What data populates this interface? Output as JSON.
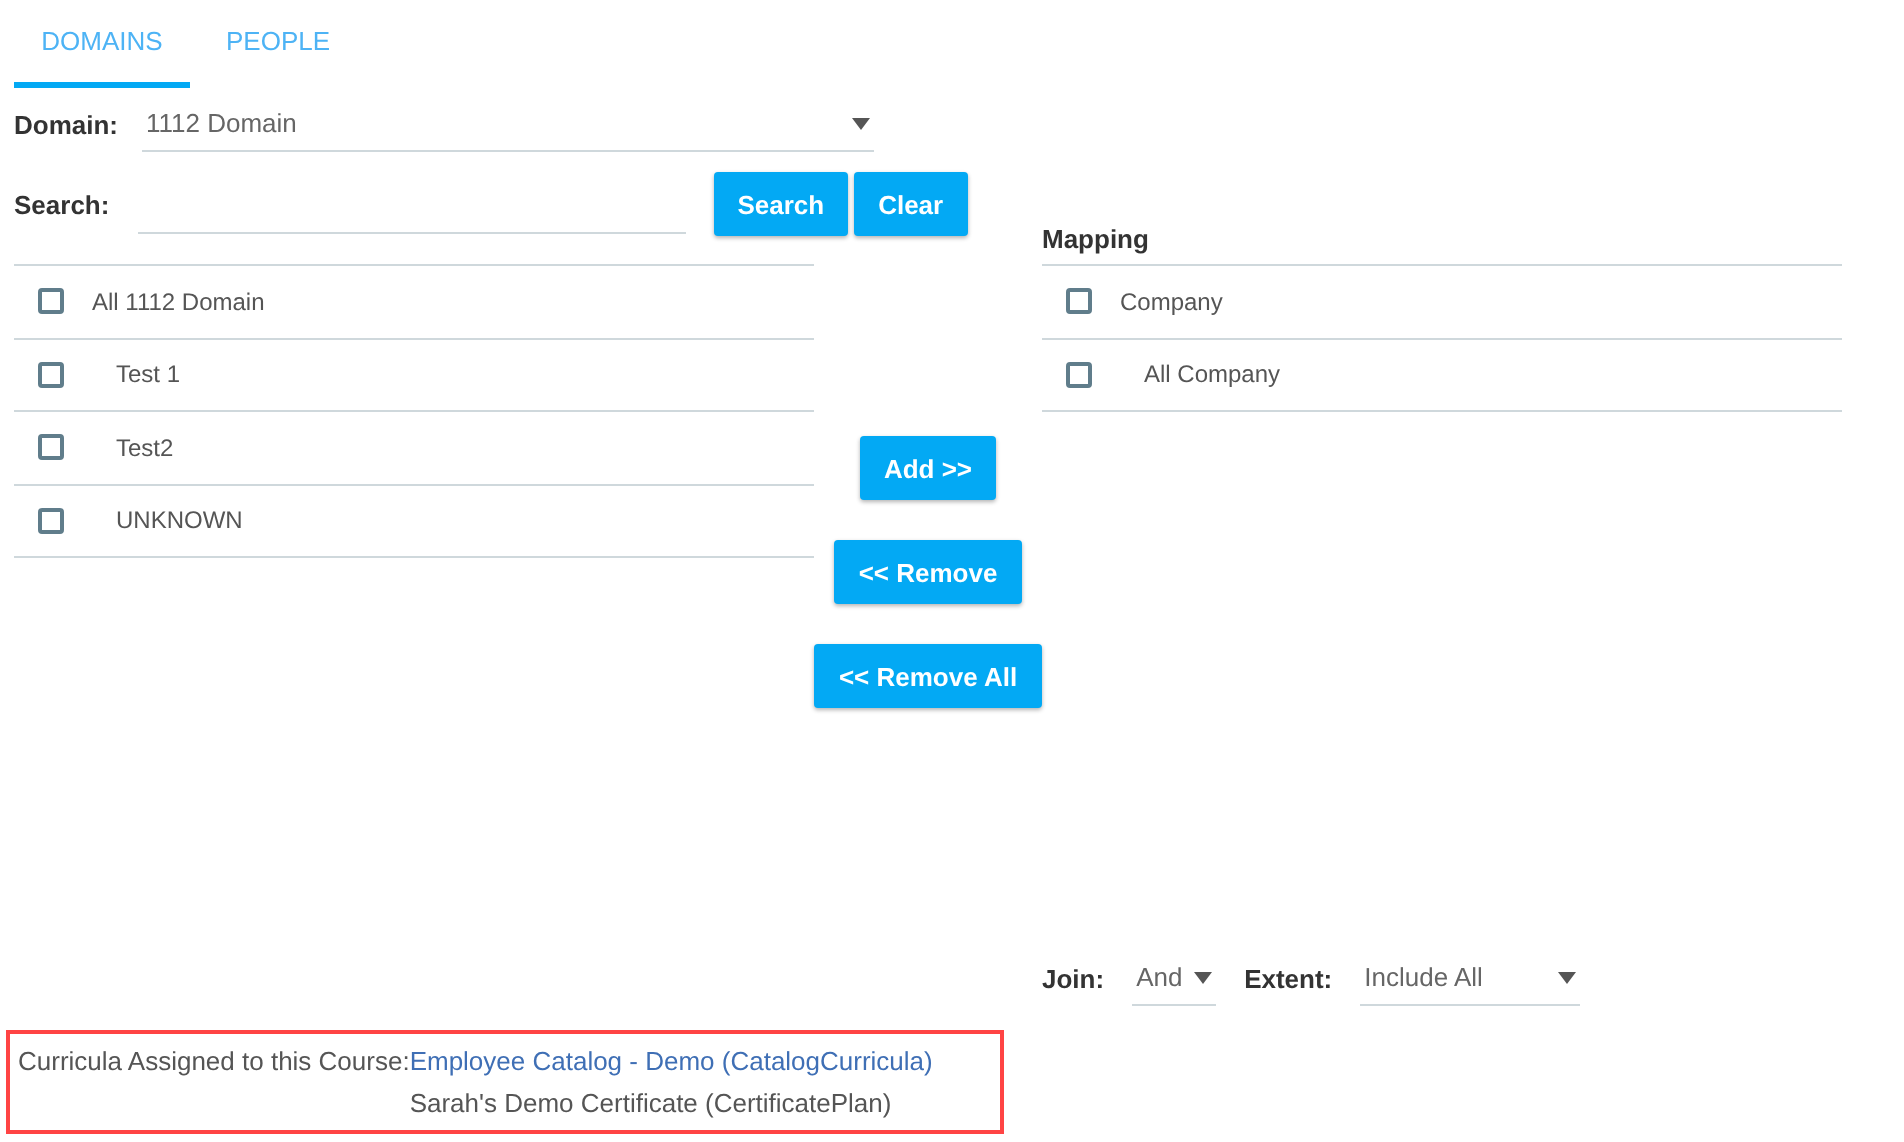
{
  "tabs": [
    {
      "label": "DOMAINS",
      "selected": true
    },
    {
      "label": "PEOPLE",
      "selected": false
    }
  ],
  "domain": {
    "label": "Domain:",
    "value": "1112 Domain"
  },
  "search": {
    "label": "Search:",
    "buttons": [
      "Search",
      "Clear"
    ]
  },
  "left_list": {
    "items": [
      {
        "label": "All 1112 Domain",
        "checked": false,
        "children": [
          {
            "label": "Test 1",
            "checked": false
          },
          {
            "label": "Test2",
            "checked": false
          },
          {
            "label": "UNKNOWN",
            "checked": false
          }
        ]
      }
    ]
  },
  "transfer_buttons": [
    "Add >>",
    "<< Remove",
    "<< Remove All"
  ],
  "mapping": {
    "title": "Mapping",
    "items": [
      {
        "label": "Company",
        "checked": false,
        "children": [
          {
            "label": "All Company",
            "checked": false
          }
        ]
      }
    ]
  },
  "join": {
    "label": "Join:",
    "value": "And"
  },
  "extent": {
    "label": "Extent:",
    "value": "Include All"
  },
  "curricula": {
    "label": "Curricula Assigned to this Course:",
    "highlighted": true,
    "items": [
      {
        "text": "Employee Catalog - Demo (CatalogCurricula)",
        "link": true
      },
      {
        "text": "Sarah's Demo Certificate (CertificatePlan)",
        "link": false
      }
    ]
  }
}
